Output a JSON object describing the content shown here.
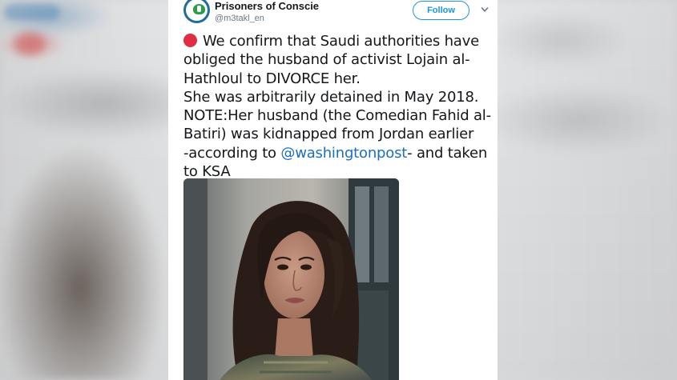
{
  "tweet": {
    "account_name": "Prisoners of Conscie",
    "handle": "@m3takl_en",
    "follow_label": "Follow",
    "lines": [
      "We confirm that Saudi authorities have",
      "obliged the husband of activist Lojain al-",
      "Hathloul to DIVORCE her.",
      "She was arbitrarily detained in May 2018.",
      "NOTE:Her husband (the Comedian Fahid al-",
      "Batiri) was kidnapped from Jordan earlier",
      "-according to ",
      "to KSA"
    ],
    "mention": "@washingtonpost",
    "after_mention": "- and taken"
  },
  "icons": {
    "status_dot": "red-circle-icon",
    "menu": "chevron-down-icon",
    "avatar": "organization-logo"
  },
  "colors": {
    "follow_blue": "#1b95e0",
    "mention_blue": "#1b6fc0",
    "red_dot": "#dd2e44"
  }
}
